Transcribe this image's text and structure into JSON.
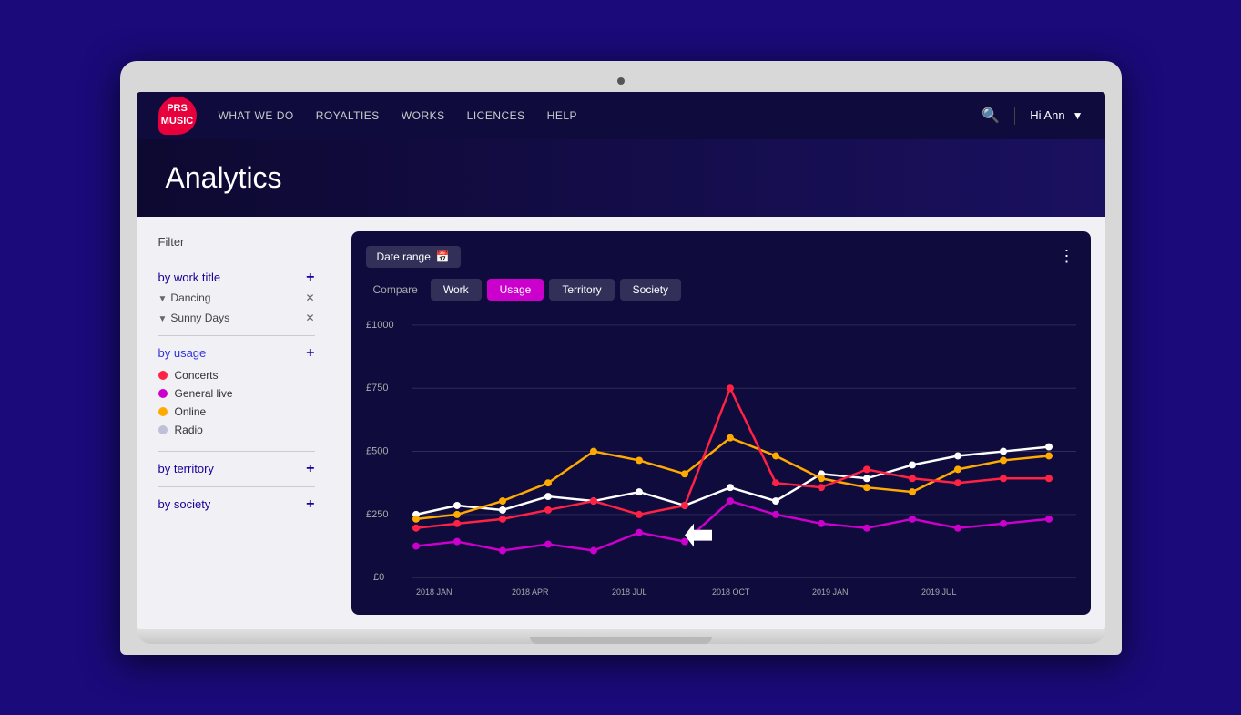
{
  "nav": {
    "logo_text": "PRS\nMUSIC",
    "links": [
      "WHAT WE DO",
      "ROYALTIES",
      "WORKS",
      "LICENCES",
      "HELP"
    ],
    "user_greeting": "Hi Ann",
    "search_icon": "🔍",
    "chevron_icon": "▼"
  },
  "page": {
    "title": "Analytics"
  },
  "sidebar": {
    "filter_title": "Filter",
    "sections": [
      {
        "id": "work-title",
        "label": "by work title",
        "active": false,
        "tags": [
          "Dancing",
          "Sunny Days"
        ]
      },
      {
        "id": "usage",
        "label": "by usage",
        "active": true,
        "legend": [
          {
            "label": "Concerts",
            "color": "#ff2244"
          },
          {
            "label": "General live",
            "color": "#cc00cc"
          },
          {
            "label": "Online",
            "color": "#ffaa00"
          },
          {
            "label": "Radio",
            "color": "#aaaacc"
          }
        ]
      },
      {
        "id": "territory",
        "label": "by territory",
        "active": false
      },
      {
        "id": "society",
        "label": "by society",
        "active": false
      }
    ]
  },
  "chart": {
    "date_range_label": "Date range",
    "date_icon": "📅",
    "menu_icon": "⋮",
    "tabs": [
      "Compare",
      "Work",
      "Usage",
      "Territory",
      "Society"
    ],
    "active_tab": "Usage",
    "y_labels": [
      "£1000",
      "£750",
      "£500",
      "£250",
      "£0"
    ],
    "x_labels": [
      "2018 JAN",
      "2018 APR",
      "2018 JUL",
      "2018 OCT",
      "2019 JAN",
      "2019 JUL"
    ],
    "colors": {
      "concerts": "#ff2244",
      "general_live": "#cc00cc",
      "online": "#ffaa00",
      "radio": "#aaaacc",
      "white": "#ffffff"
    }
  }
}
